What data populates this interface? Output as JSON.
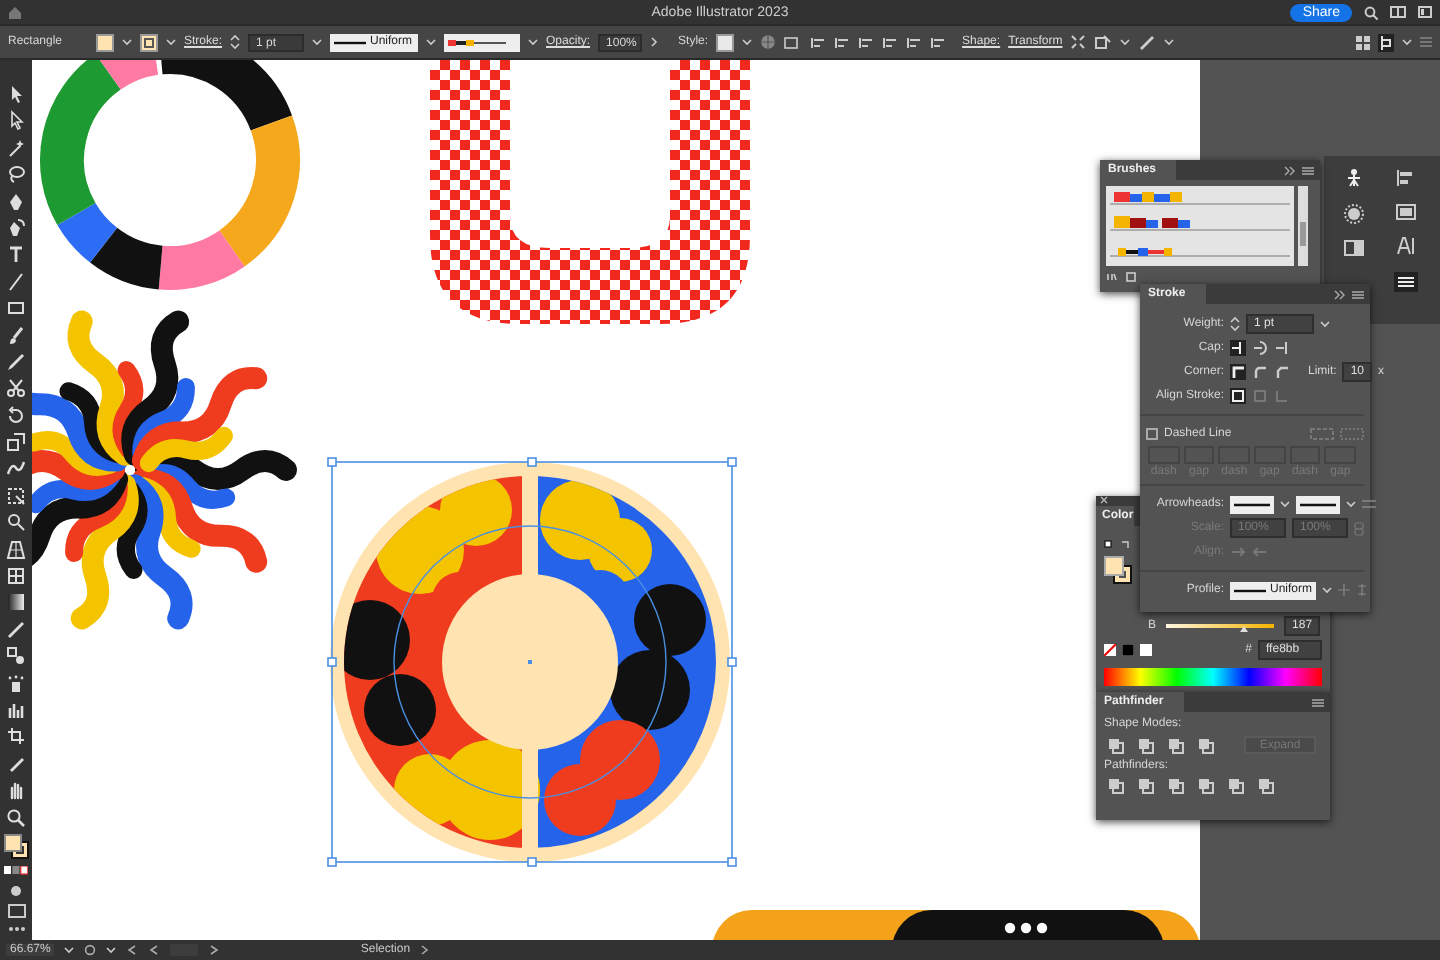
{
  "window": {
    "title": "Adobe Illustrator 2023",
    "share_button": "Share"
  },
  "control_bar": {
    "object_type": "Rectangle",
    "stroke_link": "Stroke:",
    "stroke_weight": "1 pt",
    "stroke_profile": "Uniform",
    "opacity_link": "Opacity:",
    "opacity": "100%",
    "style_label": "Style:",
    "shape_link": "Shape:",
    "transform_link": "Transform"
  },
  "panels": {
    "brushes": {
      "title": "Brushes"
    },
    "stroke": {
      "title": "Stroke",
      "weight_label": "Weight:",
      "weight": "1 pt",
      "cap_label": "Cap:",
      "corner_label": "Corner:",
      "limit_label": "Limit:",
      "limit": "10",
      "limit_unit": "x",
      "align_label": "Align Stroke:",
      "dashed_line": {
        "label": "Dashed Line",
        "checked": false
      },
      "dash_fields": [
        "dash",
        "gap",
        "dash",
        "gap",
        "dash",
        "gap"
      ],
      "arrowheads_label": "Arrowheads:",
      "scale_label": "Scale:",
      "scale": [
        "100%",
        "100%"
      ],
      "arrow_align_label": "Align:",
      "profile_label": "Profile:",
      "profile": "Uniform"
    },
    "color": {
      "title": "Color",
      "channel": {
        "label": "B",
        "level": 0.73,
        "value": "187"
      },
      "hex_label": "#",
      "hex": "ffe8bb"
    },
    "pathfinder": {
      "title": "Pathfinder",
      "shape_modes_label": "Shape Modes:",
      "expand_button": {
        "label": "Expand",
        "disabled": true
      },
      "pathfinders_label": "Pathfinders:"
    }
  },
  "status_bar": {
    "zoom": "66.67%",
    "tool": "Selection"
  }
}
